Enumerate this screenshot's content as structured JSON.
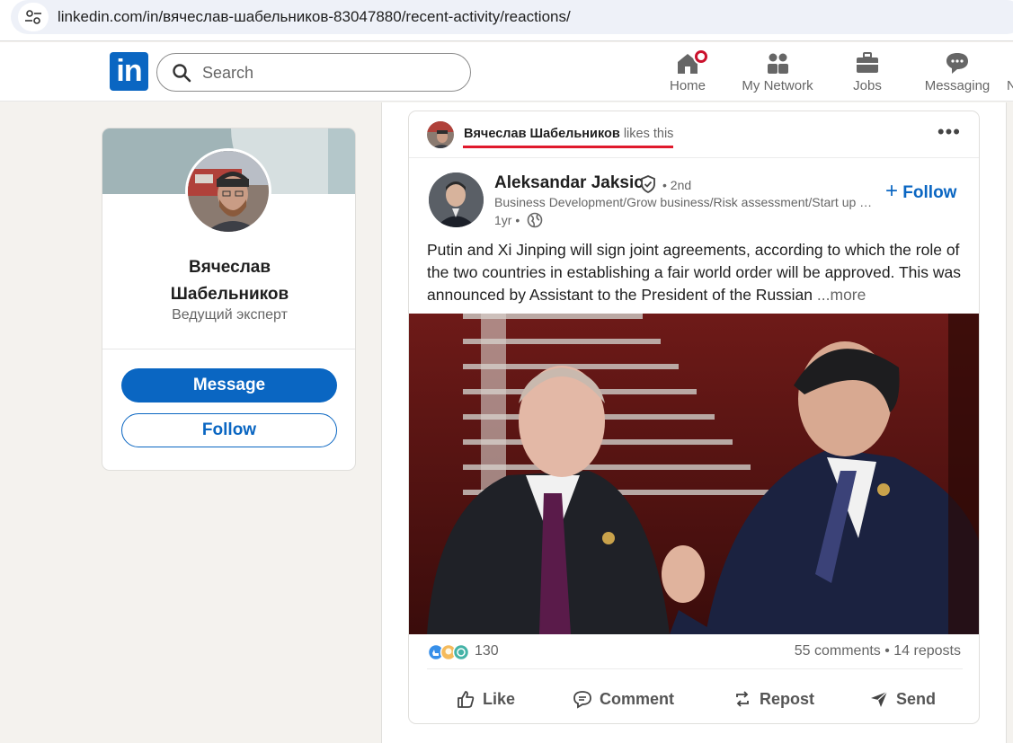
{
  "browser": {
    "url": "linkedin.com/in/вячеслав-шабельников-83047880/recent-activity/reactions/"
  },
  "nav": {
    "logo_text": "in",
    "search_placeholder": "Search",
    "items": [
      {
        "label": "Home",
        "icon": "home-icon"
      },
      {
        "label": "My Network",
        "icon": "people-icon"
      },
      {
        "label": "Jobs",
        "icon": "briefcase-icon"
      },
      {
        "label": "Messaging",
        "icon": "chat-icon"
      }
    ]
  },
  "profile": {
    "name": "Вячеслав Шабельников",
    "title": "Ведущий эксперт",
    "message_label": "Message",
    "follow_label": "Follow"
  },
  "post": {
    "context_name": "Вячеслав Шабельников",
    "context_action": "likes this",
    "author_name": "Aleksandar Jaksic",
    "degree": "• 2nd",
    "headline": "Business Development/Grow business/Risk assessment/Start up consulting",
    "time": "1yr •",
    "follow_label": "Follow",
    "text": "Putin and Xi Jinping will sign joint agreements, according to which the role of the two countries in establishing a fair world order will be approved. This was announced by Assistant to the President of the Russian",
    "more_label": "...more",
    "reaction_count": "130",
    "comments_reposts": "55 comments • 14 reposts",
    "actions": {
      "like": "Like",
      "comment": "Comment",
      "repost": "Repost",
      "send": "Send"
    }
  },
  "colors": {
    "brand": "#0a66c2",
    "notification": "#cb112d",
    "highlight_underline": "#e0192c"
  }
}
